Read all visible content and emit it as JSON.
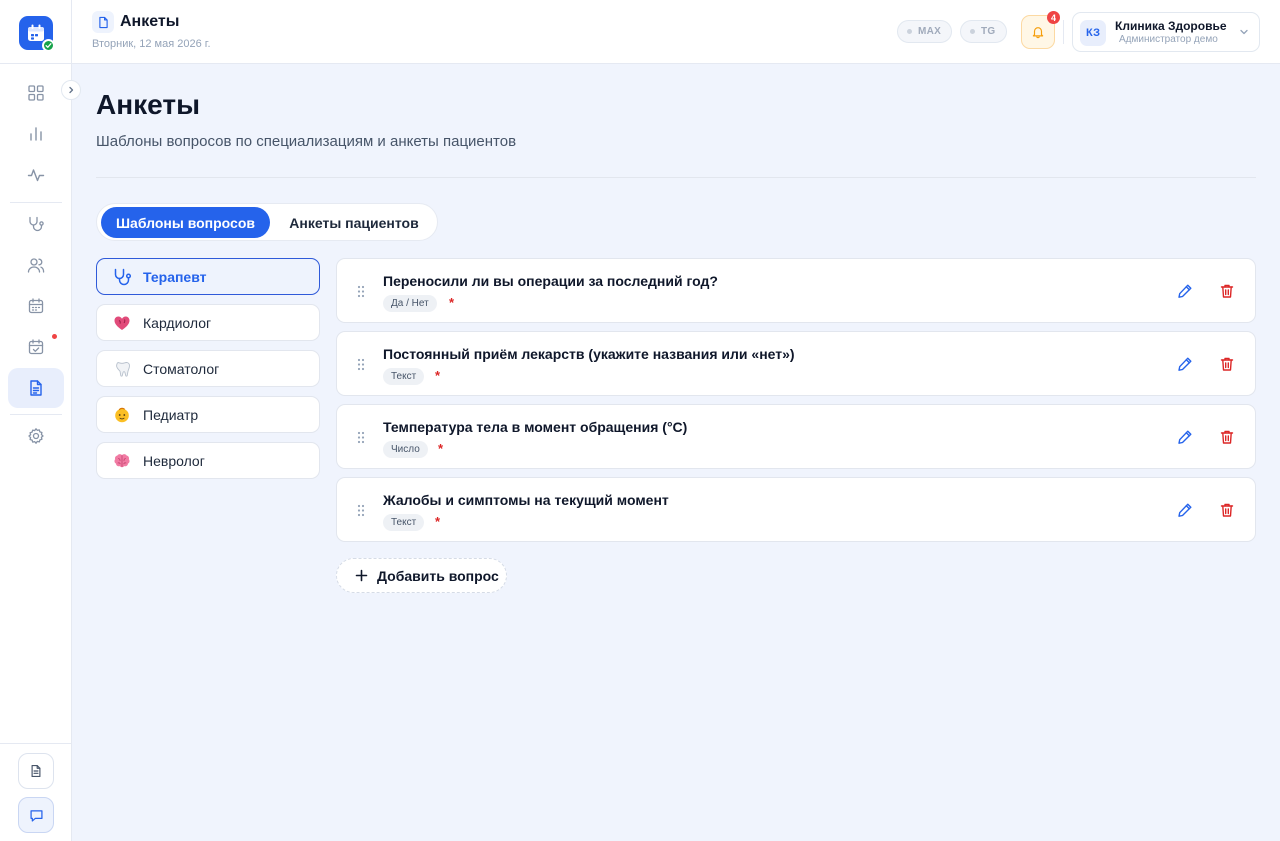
{
  "app": {
    "brand_color": "#2563eb",
    "danger_color": "#dc2626"
  },
  "sidebar": {
    "nav": [
      {
        "icon": "dashboard-icon"
      },
      {
        "icon": "bar-chart-icon"
      },
      {
        "icon": "activity-icon"
      },
      {
        "icon": "stethoscope-icon"
      },
      {
        "icon": "users-icon"
      },
      {
        "icon": "calendar-icon"
      },
      {
        "icon": "calendar-check-icon",
        "has_alert": true
      },
      {
        "icon": "document-icon",
        "active": true
      },
      {
        "icon": "gear-icon"
      }
    ],
    "bottom": [
      {
        "icon": "document-icon"
      },
      {
        "icon": "chat-icon"
      }
    ]
  },
  "header": {
    "title": "Анкеты",
    "date": "Вторник, 12 мая 2026 г.",
    "pills": [
      "MAX",
      "TG"
    ],
    "notifications_count": "4",
    "account": {
      "initials": "КЗ",
      "name": "Клиника Здоровье",
      "role": "Администратор демо"
    }
  },
  "main": {
    "title": "Анкеты",
    "subtitle": "Шаблоны вопросов по специализациям и анкеты пациентов",
    "tabs": [
      {
        "label": "Шаблоны вопросов",
        "active": true
      },
      {
        "label": "Анкеты пациентов",
        "active": false
      }
    ],
    "specializations": [
      {
        "label": "Терапевт",
        "icon": "stethoscope-icon",
        "active": true
      },
      {
        "label": "Кардиолог",
        "icon": "heart-organ-icon",
        "active": false
      },
      {
        "label": "Стоматолог",
        "icon": "tooth-icon",
        "active": false
      },
      {
        "label": "Педиатр",
        "icon": "baby-icon",
        "active": false
      },
      {
        "label": "Невролог",
        "icon": "brain-icon",
        "active": false
      }
    ],
    "questions": [
      {
        "text": "Переносили ли вы операции за последний год?",
        "type": "Да / Нет",
        "required": "*"
      },
      {
        "text": "Постоянный приём лекарств (укажите названия или «нет»)",
        "type": "Текст",
        "required": "*"
      },
      {
        "text": "Температура тела в момент обращения (°C)",
        "type": "Число",
        "required": "*"
      },
      {
        "text": "Жалобы и симптомы на текущий момент",
        "type": "Текст",
        "required": "*"
      }
    ],
    "add_question_label": "Добавить вопрос"
  }
}
